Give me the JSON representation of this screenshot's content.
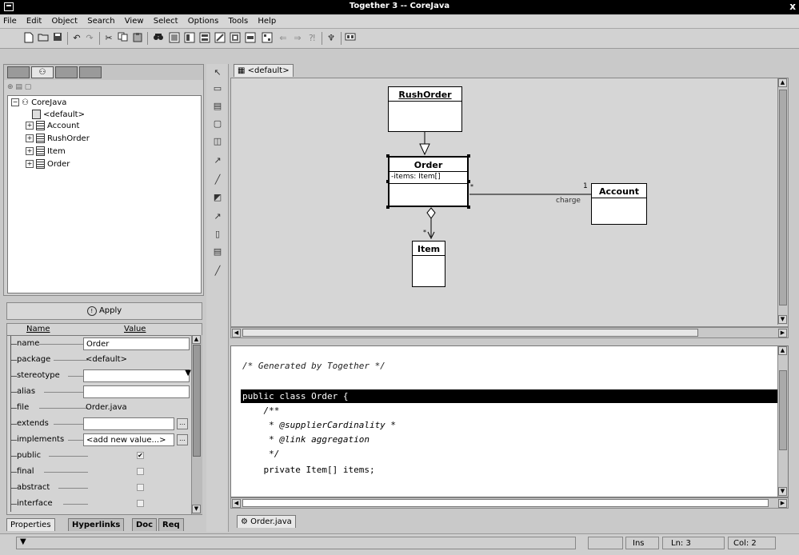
{
  "window": {
    "title": "Together 3 -- CoreJava",
    "close_glyph": "x"
  },
  "menu": [
    "File",
    "Edit",
    "Object",
    "Search",
    "View",
    "Select",
    "Options",
    "Tools",
    "Help"
  ],
  "toolbar": {
    "icons": [
      "new-file-icon",
      "open-folder-icon",
      "save-icon",
      "undo-icon",
      "redo-icon",
      "cut-icon",
      "copy-icon",
      "paste-icon",
      "find-icon",
      "view-1-icon",
      "view-2-icon",
      "view-3-icon",
      "view-4-icon",
      "view-5-icon",
      "view-6-icon",
      "view-7-icon",
      "back-icon",
      "forward-icon",
      "help-icon",
      "tools-icon",
      "options-icon"
    ]
  },
  "explorer": {
    "tabs": [
      "directory-tab-icon",
      "model-tab-icon",
      "favorites-tab-icon",
      "diagrams-tab-icon"
    ],
    "tree": {
      "root": "CoreJava",
      "default_pkg": "<default>",
      "classes": [
        "Account",
        "RushOrder",
        "Item",
        "Order"
      ]
    }
  },
  "apply_label": "Apply",
  "properties": {
    "header_name": "Name",
    "header_value": "Value",
    "rows": [
      {
        "name": "name",
        "value": "Order"
      },
      {
        "name": "package",
        "value": "<default>"
      },
      {
        "name": "stereotype",
        "value": ""
      },
      {
        "name": "alias",
        "value": ""
      },
      {
        "name": "file",
        "value": "Order.java"
      },
      {
        "name": "extends",
        "value": ""
      },
      {
        "name": "implements",
        "value": "<add new value...>"
      },
      {
        "name": "public",
        "value": "✔"
      },
      {
        "name": "final",
        "value": ""
      },
      {
        "name": "abstract",
        "value": ""
      },
      {
        "name": "interface",
        "value": ""
      }
    ]
  },
  "bottom_tabs": [
    "Properties",
    "Hyperlinks",
    "Doc",
    "Req"
  ],
  "diagram": {
    "tab_label": "<default>",
    "classes": {
      "rushorder": "RushOrder",
      "order": "Order",
      "order_attr": "-items: Item[]",
      "account": "Account",
      "item": "Item"
    },
    "labels": {
      "mult_one": "1",
      "role_charge": "charge",
      "mult_many": "*",
      "item_mult": "*"
    }
  },
  "editor": {
    "lines": [
      "/* Generated by Together */",
      "public class Order {",
      "    /**",
      "     * @supplierCardinality *",
      "     * @link aggregation",
      "     */",
      "    private Item[] items;"
    ],
    "tab_label": "Order.java"
  },
  "status": {
    "mode": "Ins",
    "line": "Ln: 3",
    "col": "Col: 2"
  }
}
